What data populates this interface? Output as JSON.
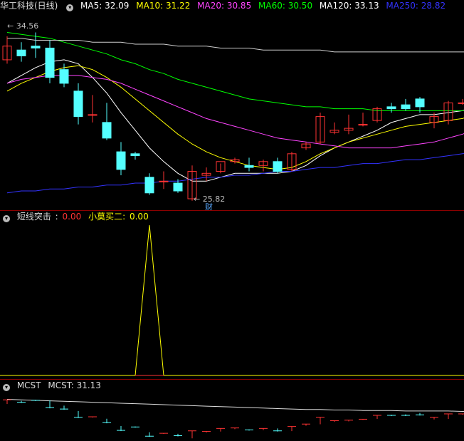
{
  "main": {
    "title": "华工科技(日线)",
    "ma": [
      {
        "label": "MA5: 32.09",
        "color": "#ffffff"
      },
      {
        "label": "MA10: 31.22",
        "color": "#ffff00"
      },
      {
        "label": "MA20: 30.85",
        "color": "#ff44ff"
      },
      {
        "label": "MA60: 30.50",
        "color": "#00ff00"
      },
      {
        "label": "MA120: 33.13",
        "color": "#ffffff"
      },
      {
        "label": "MA250: 28.82",
        "color": "#3333ff"
      }
    ],
    "high_label": "34.56",
    "low_label": "25.82",
    "badge": "财"
  },
  "indicator": {
    "name": "短线突击",
    "v1_label": "0.00",
    "name2": "小莫买二",
    "v2_label": "0.00"
  },
  "mcst": {
    "name": "MCST",
    "value_label": "MCST: 31.13"
  },
  "colors": {
    "up": "#ff3333",
    "down": "#54ffff",
    "separator": "#8b0000"
  },
  "candles": [
    [
      32.8,
      34.0,
      32.6,
      33.5
    ],
    [
      33.3,
      33.7,
      32.7,
      33.0
    ],
    [
      33.5,
      34.2,
      32.9,
      33.4
    ],
    [
      33.4,
      33.8,
      31.6,
      31.9
    ],
    [
      32.3,
      32.6,
      31.4,
      31.6
    ],
    [
      31.2,
      31.6,
      29.5,
      29.9
    ],
    [
      30.0,
      31.0,
      29.6,
      30.0
    ],
    [
      29.6,
      30.6,
      28.7,
      28.8
    ],
    [
      28.1,
      28.6,
      26.9,
      27.2
    ],
    [
      28.0,
      28.1,
      27.7,
      27.9
    ],
    [
      26.8,
      27.0,
      25.9,
      26.0
    ],
    [
      26.6,
      27.1,
      26.2,
      26.6
    ],
    [
      26.5,
      26.7,
      26.0,
      26.1
    ],
    [
      25.7,
      27.4,
      25.6,
      27.1
    ],
    [
      26.9,
      27.3,
      26.6,
      27.0
    ],
    [
      27.1,
      27.5,
      27.0,
      27.6
    ],
    [
      27.6,
      27.8,
      27.5,
      27.7
    ],
    [
      27.4,
      27.8,
      27.1,
      27.3
    ],
    [
      27.4,
      27.7,
      27.1,
      27.6
    ],
    [
      27.6,
      27.8,
      27.0,
      27.1
    ],
    [
      27.2,
      28.1,
      27.1,
      28.0
    ],
    [
      28.3,
      28.6,
      28.2,
      28.5
    ],
    [
      28.6,
      30.1,
      28.5,
      29.9
    ],
    [
      29.1,
      29.6,
      29.0,
      29.2
    ],
    [
      29.2,
      30.0,
      29.0,
      29.3
    ],
    [
      29.5,
      30.1,
      29.4,
      29.5
    ],
    [
      29.7,
      30.4,
      29.6,
      30.3
    ],
    [
      30.4,
      30.6,
      30.1,
      30.3
    ],
    [
      30.5,
      30.8,
      30.2,
      30.3
    ],
    [
      30.8,
      30.9,
      30.1,
      30.4
    ],
    [
      29.6,
      30.1,
      29.3,
      29.9
    ],
    [
      29.7,
      30.7,
      29.5,
      30.6
    ],
    [
      30.6,
      30.8,
      30.5,
      30.6
    ],
    [
      30.8,
      33.3,
      30.7,
      31.8
    ]
  ],
  "ma_series": {
    "ma5": [
      31.6,
      32.0,
      32.4,
      32.7,
      32.8,
      32.6,
      31.9,
      31.1,
      30.1,
      29.2,
      28.3,
      27.6,
      27.0,
      26.6,
      26.6,
      26.8,
      27.0,
      27.0,
      27.0,
      27.0,
      27.1,
      27.4,
      27.9,
      28.3,
      28.6,
      28.9,
      29.2,
      29.6,
      29.8,
      30.0,
      30.0,
      30.1,
      30.2,
      30.5
    ],
    "ma10": [
      31.2,
      31.6,
      31.9,
      32.2,
      32.4,
      32.5,
      32.3,
      31.9,
      31.4,
      30.8,
      30.2,
      29.6,
      29.0,
      28.5,
      28.1,
      27.8,
      27.6,
      27.4,
      27.3,
      27.2,
      27.3,
      27.6,
      28.0,
      28.3,
      28.6,
      28.8,
      29.0,
      29.2,
      29.4,
      29.5,
      29.6,
      29.7,
      29.8,
      30.1
    ],
    "ma20": [
      31.6,
      31.8,
      31.9,
      32.0,
      32.0,
      32.0,
      31.9,
      31.8,
      31.6,
      31.3,
      31.0,
      30.7,
      30.4,
      30.1,
      29.8,
      29.6,
      29.4,
      29.2,
      29.0,
      28.8,
      28.7,
      28.6,
      28.5,
      28.4,
      28.3,
      28.3,
      28.3,
      28.3,
      28.4,
      28.5,
      28.6,
      28.8,
      29.0,
      29.3
    ],
    "ma60": [
      34.2,
      34.1,
      34.0,
      33.9,
      33.7,
      33.5,
      33.3,
      33.1,
      32.8,
      32.6,
      32.3,
      32.1,
      31.8,
      31.6,
      31.4,
      31.2,
      31.0,
      30.8,
      30.7,
      30.6,
      30.5,
      30.4,
      30.4,
      30.3,
      30.3,
      30.3,
      30.2,
      30.2,
      30.2,
      30.2,
      30.2,
      30.2,
      30.2,
      30.3
    ],
    "ma120": [
      33.9,
      33.9,
      33.8,
      33.8,
      33.8,
      33.8,
      33.7,
      33.7,
      33.7,
      33.6,
      33.6,
      33.6,
      33.5,
      33.5,
      33.5,
      33.4,
      33.4,
      33.4,
      33.3,
      33.3,
      33.3,
      33.3,
      33.3,
      33.2,
      33.2,
      33.2,
      33.2,
      33.2,
      33.2,
      33.2,
      33.2,
      33.2,
      33.2,
      33.2
    ],
    "ma250": [
      26.0,
      26.1,
      26.1,
      26.2,
      26.2,
      26.3,
      26.3,
      26.4,
      26.4,
      26.5,
      26.5,
      26.6,
      26.6,
      26.7,
      26.8,
      26.8,
      26.9,
      26.9,
      27.0,
      27.1,
      27.1,
      27.2,
      27.3,
      27.3,
      27.4,
      27.5,
      27.5,
      27.6,
      27.7,
      27.7,
      27.8,
      27.9,
      28.0,
      28.1
    ]
  },
  "indicator_series": [
    0,
    0,
    0,
    0,
    0,
    0,
    0,
    0,
    0,
    0,
    1,
    0,
    0,
    0,
    0,
    0,
    0,
    0,
    0,
    0,
    0,
    0,
    0,
    0,
    0,
    0,
    0,
    0,
    0,
    0,
    0,
    0,
    0,
    0
  ],
  "mcst_series": [
    33.6,
    33.5,
    33.4,
    33.3,
    33.2,
    33.1,
    33.0,
    32.9,
    32.8,
    32.7,
    32.6,
    32.5,
    32.4,
    32.3,
    32.2,
    32.1,
    32.0,
    31.9,
    31.8,
    31.7,
    31.6,
    31.5,
    31.5,
    31.4,
    31.4,
    31.3,
    31.3,
    31.3,
    31.2,
    31.2,
    31.2,
    31.2,
    31.1,
    31.1
  ]
}
